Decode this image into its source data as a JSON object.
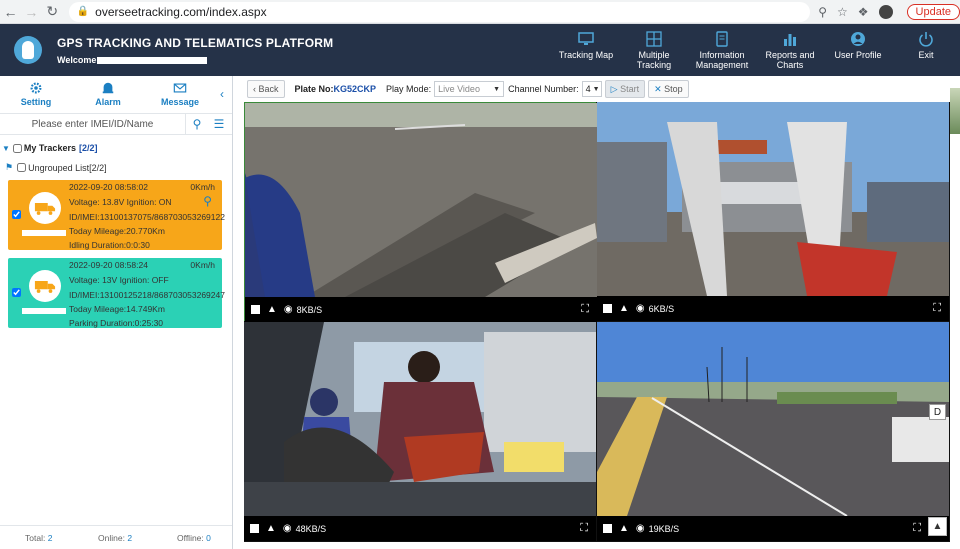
{
  "browser": {
    "url": "overseetracking.com/index.aspx",
    "update_label": "Update"
  },
  "header": {
    "title": "GPS TRACKING AND TELEMATICS PLATFORM",
    "welcome": "Welcome",
    "menu": [
      {
        "label": "Tracking Map",
        "icon": "monitor-icon"
      },
      {
        "label": "Multiple Tracking",
        "icon": "grid-icon"
      },
      {
        "label": "Information Management",
        "icon": "document-icon"
      },
      {
        "label": "Reports and Charts",
        "icon": "bar-chart-icon"
      },
      {
        "label": "User Profile",
        "icon": "user-icon"
      },
      {
        "label": "Exit",
        "icon": "power-icon"
      }
    ]
  },
  "sidebar": {
    "tabs": [
      {
        "label": "Setting",
        "icon": "gear-icon"
      },
      {
        "label": "Alarm",
        "icon": "alarm-icon"
      },
      {
        "label": "Message",
        "icon": "envelope-icon"
      }
    ],
    "search_placeholder": "Please enter IMEI/ID/Name",
    "tree": {
      "root_label": "My Trackers",
      "root_count": "[2/2]",
      "group_label": "Ungrouped List[2/2]"
    },
    "trackers": [
      {
        "timestamp": "2022-09-20 08:58:02",
        "speed": "0Km/h",
        "voltage_ignition": "Voltage: 13.8V    Ignition: ON",
        "imei": "ID/IMEI:13100137075/868703053269122",
        "mileage": "Today Mileage:20.770Km",
        "duration": "Idling Duration:0:0:30",
        "color": "#f7a619"
      },
      {
        "timestamp": "2022-09-20 08:58:24",
        "speed": "0Km/h",
        "voltage_ignition": "Voltage: 13V    Ignition: OFF",
        "imei": "ID/IMEI:13100125218/868703053269247",
        "mileage": "Today Mileage:14.749Km",
        "duration": "Parking Duration:0:25:30",
        "color": "#2bd1b5"
      }
    ],
    "footer": {
      "total_label": "Total:",
      "total_value": "2",
      "online_label": "Online:",
      "online_value": "2",
      "offline_label": "Offline:",
      "offline_value": "0"
    }
  },
  "toolbar": {
    "back_label": "Back",
    "plate_label": "Plate No:",
    "plate_value": "KG52CKP",
    "play_mode_label": "Play Mode:",
    "play_mode_value": "Live Video",
    "channel_label": "Channel Number:",
    "channel_value": "4",
    "start_label": "Start",
    "stop_label": "Stop"
  },
  "videos": [
    {
      "rate": "8KB/S"
    },
    {
      "rate": "6KB/S"
    },
    {
      "rate": "48KB/S"
    },
    {
      "rate": "19KB/S"
    }
  ],
  "overlay": {
    "d_badge": "D"
  }
}
